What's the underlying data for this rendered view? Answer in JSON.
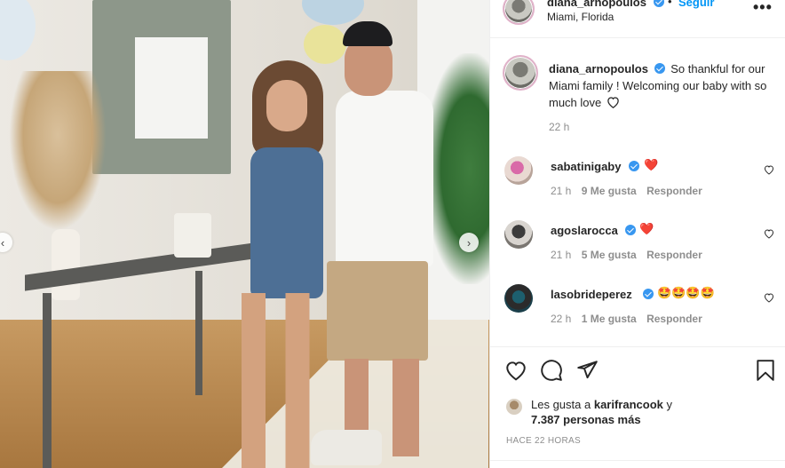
{
  "post": {
    "username": "diana_arnopoulos",
    "follow_label": "Seguir",
    "location": "Miami, Florida",
    "more_label": "•••",
    "caption": "So thankful for our Miami family ! Welcoming our baby with so much love",
    "caption_time": "22 h",
    "comments": [
      {
        "user": "sabatinigaby",
        "text": "❤️",
        "time": "21 h",
        "likes": "9 Me gusta",
        "reply": "Responder"
      },
      {
        "user": "agoslarocca",
        "text": "❤️",
        "time": "21 h",
        "likes": "5 Me gusta",
        "reply": "Responder"
      },
      {
        "user": "lasobrideperez",
        "text": "🤩🤩🤩🤩",
        "time": "22 h",
        "likes": "1 Me gusta",
        "reply": "Responder"
      }
    ],
    "likes_prefix": "Les gusta a",
    "likes_user": "karifrancook",
    "likes_suffix": "y",
    "likes_count": "7.387 personas más",
    "ago": "HACE 22 HORAS"
  },
  "icons": {
    "verified": "verified-badge",
    "like": "heart-icon",
    "comment": "comment-icon",
    "share": "share-icon",
    "save": "bookmark-icon",
    "prev": "chevron-left-icon",
    "next": "chevron-right-icon"
  },
  "colors": {
    "link": "#0095f6",
    "verified": "#3897f0",
    "muted": "#8e8e8e",
    "heart": "#ed4956"
  }
}
